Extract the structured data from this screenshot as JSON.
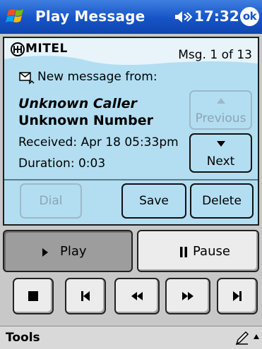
{
  "titlebar": {
    "title": "Play Message",
    "time": "17:32",
    "ok_label": "ok"
  },
  "panel": {
    "brand": "MITEL",
    "message_count": "Msg. 1 of 13",
    "new_message_label": "New message from:",
    "caller_name": "Unknown Caller",
    "caller_number": "Unknown Number",
    "received": "Received: Apr 18 05:33pm",
    "duration": "Duration: 0:03",
    "previous_label": "Previous",
    "next_label": "Next",
    "dial_label": "Dial",
    "save_label": "Save",
    "delete_label": "Delete"
  },
  "playback": {
    "play_label": "Play",
    "pause_label": "Pause"
  },
  "menu": {
    "tools_label": "Tools"
  },
  "colors": {
    "panel_bg": "#b3def2",
    "title_bar": "#1553c6",
    "disabled": "#8aa5b2"
  },
  "icons": [
    "windows-flag-icon",
    "speaker-icon",
    "envelope-icon",
    "up-arrow-icon",
    "down-arrow-icon",
    "play-icon",
    "pause-icon",
    "stop-icon",
    "skip-start-icon",
    "rewind-icon",
    "fast-forward-icon",
    "skip-end-icon",
    "pen-icon",
    "up-icon"
  ]
}
